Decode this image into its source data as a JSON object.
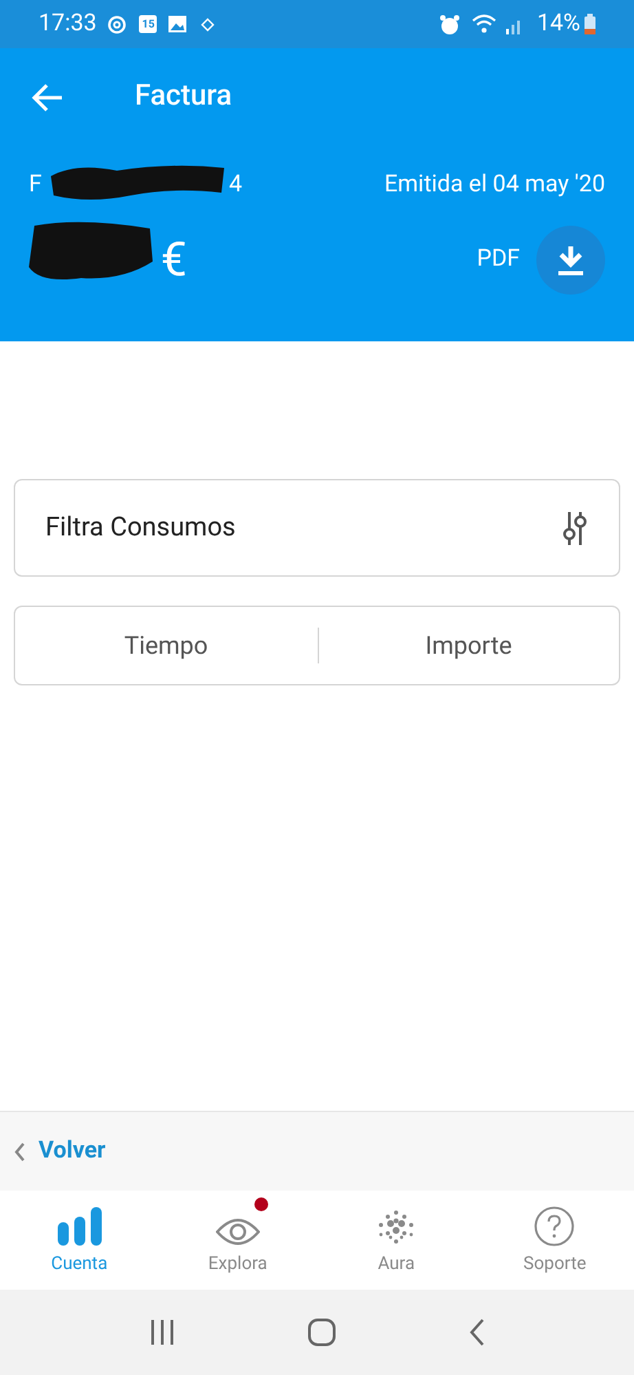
{
  "status_bar": {
    "time": "17:33",
    "calendar_day": "15",
    "battery": "14%"
  },
  "header": {
    "title": "Factura",
    "invoice_prefix": "F",
    "invoice_suffix": "4",
    "issued": "Emitida el 04 may '20",
    "amount_currency": "€",
    "pdf_label": "PDF"
  },
  "filter": {
    "label": "Filtra Consumos"
  },
  "segments": [
    {
      "label": "Tiempo"
    },
    {
      "label": "Importe"
    }
  ],
  "back_link": {
    "label": "Volver"
  },
  "bottom_nav": [
    {
      "kind": "bars",
      "label": "Cuenta",
      "selected": true,
      "badge": false
    },
    {
      "kind": "eye",
      "label": "Explora",
      "selected": false,
      "badge": true
    },
    {
      "kind": "dots",
      "label": "Aura",
      "selected": false,
      "badge": false
    },
    {
      "kind": "help",
      "label": "Soporte",
      "selected": false,
      "badge": false
    }
  ]
}
